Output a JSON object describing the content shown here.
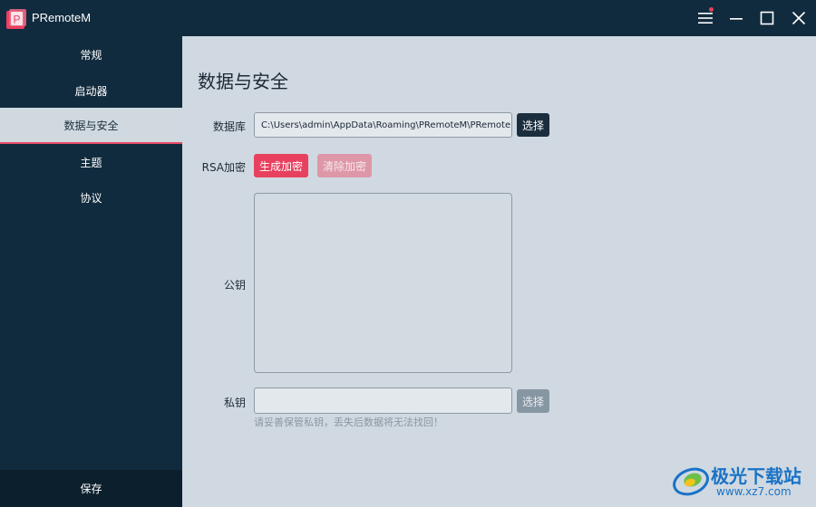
{
  "app": {
    "logo_letter": "P",
    "title": "PRemoteM"
  },
  "sidebar": {
    "items": [
      {
        "label": "常规"
      },
      {
        "label": "启动器"
      },
      {
        "label": "数据与安全"
      },
      {
        "label": "主题"
      },
      {
        "label": "协议"
      }
    ],
    "save_label": "保存"
  },
  "main": {
    "heading": "数据与安全",
    "database": {
      "label": "数据库",
      "value": "C:\\Users\\admin\\AppData\\Roaming\\PRemoteM\\PRemoteM.db",
      "choose_label": "选择"
    },
    "rsa": {
      "label": "RSA加密",
      "generate_label": "生成加密",
      "clear_label": "清除加密"
    },
    "public_key": {
      "label": "公钥",
      "value": ""
    },
    "private_key": {
      "label": "私钥",
      "value": "",
      "choose_label": "选择",
      "hint": "请妥善保管私钥，丢失后数据将无法找回！"
    }
  },
  "watermark": {
    "brand": "极光下载站",
    "url": "www.xz7.com"
  },
  "colors": {
    "titlebar": "#112b3e",
    "sidebar": "#112b3e",
    "content_bg": "#d0d9e1",
    "accent": "#e8405f",
    "accent_disabled": "#de97a7",
    "dark_button": "#1b2e3e"
  }
}
